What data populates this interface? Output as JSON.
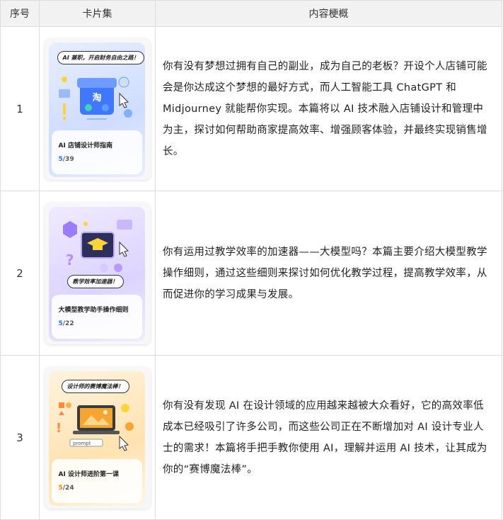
{
  "header": {
    "col_index": "序号",
    "col_cards": "卡片集",
    "col_summary": "内容梗概"
  },
  "rows": [
    {
      "index": "1",
      "card": {
        "tag": "AI 兼职，开启财务自由之路！",
        "title": "AI 店铺设计师指南",
        "current": "5",
        "total": "/39",
        "theme": "blue",
        "icon": "shop-icon",
        "shop_glyph": "淘"
      },
      "summary": "你有没有梦想过拥有自己的副业，成为自己的老板？开设个人店铺可能会是你达成这个梦想的最好方式，而人工智能工具 ChatGPT 和 Midjourney 就能帮你实现。本篇将以 AI 技术融入店铺设计和管理中为主，探讨如何帮助商家提高效率、增强顾客体验，并最终实现销售增长。"
    },
    {
      "index": "2",
      "card": {
        "tag": "教学效率加速器！",
        "title": "大模型教学助手操作细则",
        "current": "5",
        "total": "/22",
        "theme": "purple",
        "icon": "graduation-cap-icon"
      },
      "summary": "你有运用过教学效率的加速器——大模型吗？本篇主要介绍大模型教学操作细则，通过这些细则来探讨如何优化教学过程，提高教学效率，从而促进你的学习成果与发展。"
    },
    {
      "index": "3",
      "card": {
        "tag": "设计师的赛博魔法棒！",
        "title": "AI 设计师进阶第一课",
        "current": "5",
        "total": "/24",
        "theme": "orange",
        "icon": "laptop-image-icon",
        "prompt_text": "prompt"
      },
      "summary": "你有没有发现 AI 在设计领域的应用越来越被大众看好，它的高效率低成本已经吸引了许多公司，而这些公司正在不断增加对 AI 设计专业人士的需求！本篇将手把手教你使用 AI，理解并运用 AI 技术，让其成为你的“赛博魔法棒”。"
    }
  ],
  "colors": {
    "header_bg": "#f2f2f2",
    "border": "#dcdcdc",
    "accent_blue": "#2f6df6",
    "accent_orange": "#f08a00"
  }
}
